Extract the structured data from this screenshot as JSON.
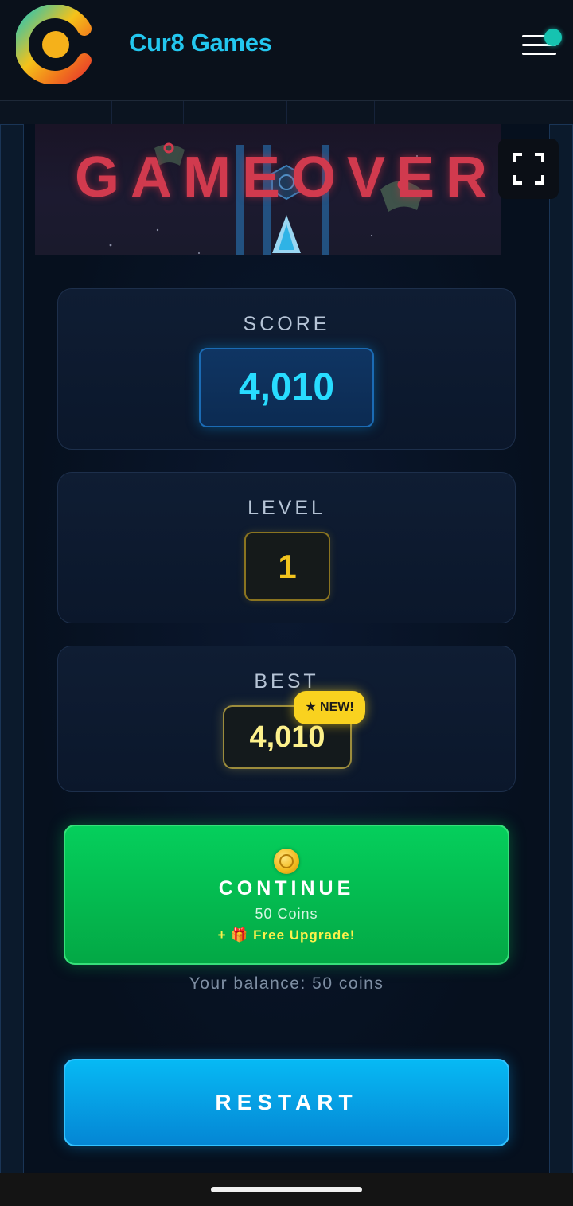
{
  "header": {
    "brand_name": "Cur8 Games",
    "logo_icon": "cur8-logo-icon",
    "menu_icon": "hamburger-menu-icon",
    "notification_dot_color": "#16c3b0"
  },
  "game": {
    "banner_title": "GAMEOVER",
    "fullscreen_icon": "fullscreen-icon",
    "stats": {
      "score": {
        "label": "SCORE",
        "value": "4,010"
      },
      "level": {
        "label": "LEVEL",
        "value": "1"
      },
      "best": {
        "label": "BEST",
        "value": "4,010",
        "badge": "★ NEW!"
      }
    },
    "continue_button": {
      "icon": "coin-icon",
      "title": "CONTINUE",
      "cost": "50 Coins",
      "bonus": "+ 🎁 Free Upgrade!"
    },
    "balance_text": "Your balance: 50 coins",
    "restart_label": "RESTART"
  },
  "colors": {
    "brand": "#23c7ef",
    "score": "#28dcff",
    "level": "#f3c51e",
    "best": "#fdf18c",
    "continue_green": "#05cf5c",
    "restart_blue": "#06b9f4",
    "game_over_red": "#d13a4e"
  }
}
